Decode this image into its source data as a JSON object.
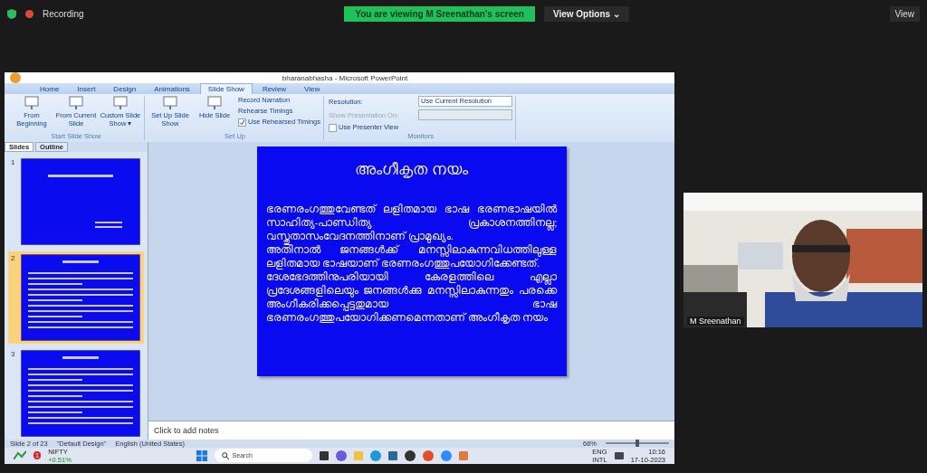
{
  "meeting_bar": {
    "recording": "Recording",
    "banner": "You are viewing M Sreenathan's screen",
    "view_options": "View Options",
    "view_options_caret": "⌄",
    "view": "View"
  },
  "window": {
    "title": "bharanabhasha - Microsoft PowerPoint"
  },
  "tabs": [
    {
      "label": "Home",
      "selected": false
    },
    {
      "label": "Insert",
      "selected": false
    },
    {
      "label": "Design",
      "selected": false
    },
    {
      "label": "Animations",
      "selected": false
    },
    {
      "label": "Slide Show",
      "selected": true
    },
    {
      "label": "Review",
      "selected": false
    },
    {
      "label": "View",
      "selected": false
    }
  ],
  "ribbon": {
    "groups": [
      {
        "label": "Start Slide Show",
        "items": [
          {
            "kind": "big",
            "label": "From Beginning"
          },
          {
            "kind": "big",
            "label": "From Current Slide"
          },
          {
            "kind": "big",
            "label": "Custom Slide Show",
            "caret": "▾"
          }
        ]
      },
      {
        "label": "Set Up",
        "items": [
          {
            "kind": "big",
            "label": "Set Up Slide Show"
          },
          {
            "kind": "big",
            "label": "Hide Slide"
          },
          {
            "kind": "small",
            "label": "Record Narration",
            "disabled": false
          },
          {
            "kind": "small",
            "label": "Rehearse Timings",
            "disabled": false
          },
          {
            "kind": "check",
            "label": "Use Rehearsed Timings",
            "checked": true,
            "disabled": false
          }
        ]
      },
      {
        "label": "Monitors",
        "items": [
          {
            "kind": "select",
            "label": "Resolution:",
            "value": "Use Current Resolution",
            "disabled": false
          },
          {
            "kind": "select",
            "label": "Show Presentation On:",
            "value": "",
            "disabled": true
          },
          {
            "kind": "check",
            "label": "Use Presenter View",
            "checked": false,
            "disabled": false
          }
        ]
      }
    ]
  },
  "pane_tabs": [
    {
      "label": "Slides",
      "selected": true
    },
    {
      "label": "Outline",
      "selected": false
    }
  ],
  "slides": [
    {
      "number": "1",
      "selected": false
    },
    {
      "number": "2",
      "selected": true
    },
    {
      "number": "3",
      "selected": false
    }
  ],
  "slide": {
    "title": "അംഗീകൃത നയം",
    "paragraphs": [
      "ഭരണരംഗത്തുവേണ്ടത് ലളിതമായ ഭാഷ ഭരണഭാഷയിൽ സാഹിത്യ-പാണ്ഡിത്യ പ്രകാശനത്തിനല്ല; വസ്തുതാസംവേദനത്തിനാണ് പ്രാമുഖ്യം.",
      "അതിനാൽ ജനങ്ങൾക്ക് മനസ്സിലാകുന്നവിധത്തിലുള്ള ലളിതമായ ഭാഷയാണ് ഭരണരംഗത്തുപയോഗിക്കേണ്ടത്.",
      "ദേശഭേദത്തിനുപരിയായി കേരളത്തിലെ എല്ലാ പ്രദേശങ്ങളിലെയും ജനങ്ങൾക്കു മനസ്സിലാകുന്നതും പരക്കെ അംഗീകരിക്കപ്പെട്ടതുമായ ഭാഷ ഭരണരംഗത്തുപയോഗിക്കണമെന്നതാണ് അംഗീകൃത നയം"
    ]
  },
  "notes": {
    "placeholder": "Click to add notes"
  },
  "status_bar": {
    "slide": "Slide 2 of 23",
    "theme": "\"Default Design\"",
    "language": "English (United States)",
    "zoom": "66%",
    "level": 0.5
  },
  "taskbar": {
    "stock": "NIFTY",
    "change": "+0.51%",
    "badge": "1",
    "search": "Search",
    "lang1": "ENG",
    "lang2": "INTL",
    "time": "10:16",
    "date": "17-10-2023"
  },
  "video": {
    "name": "M Sreenathan"
  }
}
